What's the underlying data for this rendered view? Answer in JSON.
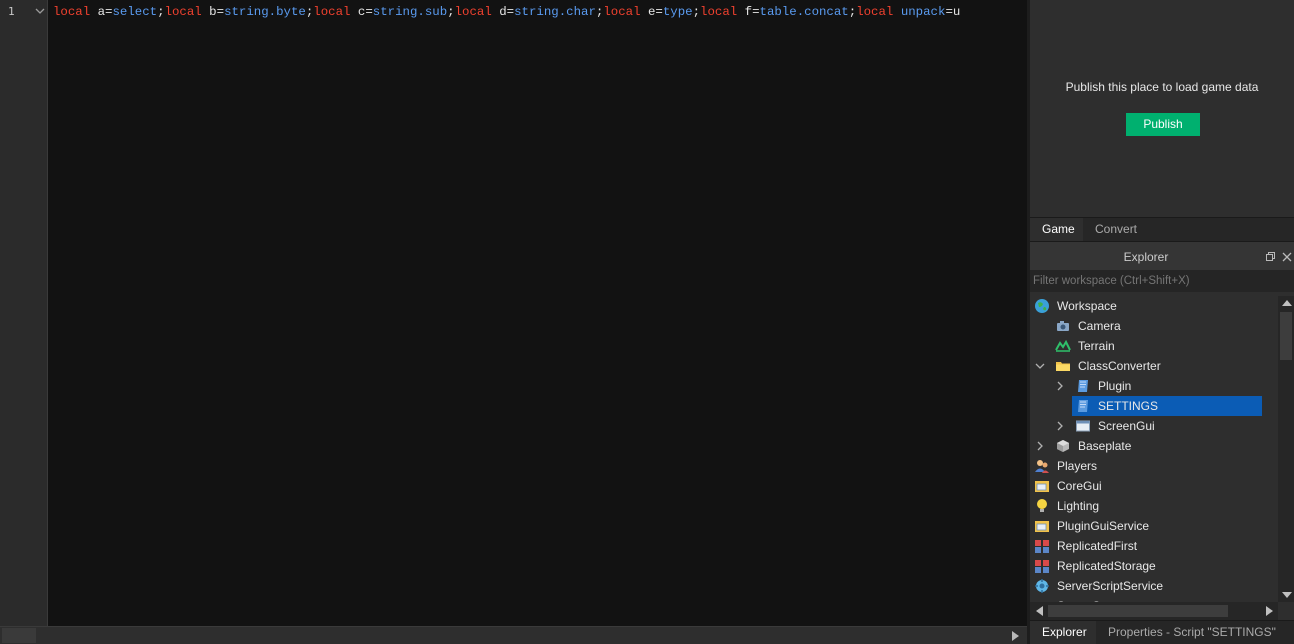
{
  "editor": {
    "line_number": "1",
    "code_tokens": [
      {
        "t": "kw",
        "v": "local"
      },
      {
        "t": "op",
        "v": " a="
      },
      {
        "t": "bi",
        "v": "select"
      },
      {
        "t": "op",
        "v": ";"
      },
      {
        "t": "kw",
        "v": "local"
      },
      {
        "t": "op",
        "v": " b="
      },
      {
        "t": "bi",
        "v": "string.byte"
      },
      {
        "t": "op",
        "v": ";"
      },
      {
        "t": "kw",
        "v": "local"
      },
      {
        "t": "op",
        "v": " c="
      },
      {
        "t": "bi",
        "v": "string.sub"
      },
      {
        "t": "op",
        "v": ";"
      },
      {
        "t": "kw",
        "v": "local"
      },
      {
        "t": "op",
        "v": " d="
      },
      {
        "t": "bi",
        "v": "string.char"
      },
      {
        "t": "op",
        "v": ";"
      },
      {
        "t": "kw",
        "v": "local"
      },
      {
        "t": "op",
        "v": " e="
      },
      {
        "t": "bi",
        "v": "type"
      },
      {
        "t": "op",
        "v": ";"
      },
      {
        "t": "kw",
        "v": "local"
      },
      {
        "t": "op",
        "v": " f="
      },
      {
        "t": "bi",
        "v": "table.concat"
      },
      {
        "t": "op",
        "v": ";"
      },
      {
        "t": "kw",
        "v": "local"
      },
      {
        "t": "op",
        "v": " "
      },
      {
        "t": "bi",
        "v": "unpack"
      },
      {
        "t": "op",
        "v": "=u"
      }
    ]
  },
  "game_panel": {
    "message": "Publish this place to load game data",
    "publish_label": "Publish"
  },
  "top_tabs": [
    {
      "label": "Game",
      "active": true
    },
    {
      "label": "Convert",
      "active": false
    }
  ],
  "explorer": {
    "title": "Explorer",
    "filter_placeholder": "Filter workspace (Ctrl+Shift+X)",
    "items": [
      {
        "label": "Workspace",
        "icon": "globe-icon",
        "indent": 0,
        "chevron": "none",
        "selected": false
      },
      {
        "label": "Camera",
        "icon": "camera-icon",
        "indent": 1,
        "chevron": "none",
        "selected": false
      },
      {
        "label": "Terrain",
        "icon": "terrain-icon",
        "indent": 1,
        "chevron": "none",
        "selected": false
      },
      {
        "label": "ClassConverter",
        "icon": "folder-icon",
        "indent": 1,
        "chevron": "down",
        "selected": false
      },
      {
        "label": "Plugin",
        "icon": "script-icon",
        "indent": 2,
        "chevron": "right",
        "selected": false
      },
      {
        "label": "SETTINGS",
        "icon": "script-icon",
        "indent": 2,
        "chevron": "none",
        "selected": true
      },
      {
        "label": "ScreenGui",
        "icon": "screen-gui-icon",
        "indent": 2,
        "chevron": "right",
        "selected": false
      },
      {
        "label": "Baseplate",
        "icon": "part-icon",
        "indent": 1,
        "chevron": "right",
        "selected": false
      },
      {
        "label": "Players",
        "icon": "players-icon",
        "indent": 0,
        "chevron": "none",
        "selected": false
      },
      {
        "label": "CoreGui",
        "icon": "core-gui-icon",
        "indent": 0,
        "chevron": "none",
        "selected": false
      },
      {
        "label": "Lighting",
        "icon": "lightbulb-icon",
        "indent": 0,
        "chevron": "none",
        "selected": false
      },
      {
        "label": "PluginGuiService",
        "icon": "core-gui-icon",
        "indent": 0,
        "chevron": "none",
        "selected": false
      },
      {
        "label": "ReplicatedFirst",
        "icon": "replicated-icon",
        "indent": 0,
        "chevron": "none",
        "selected": false
      },
      {
        "label": "ReplicatedStorage",
        "icon": "replicated-icon",
        "indent": 0,
        "chevron": "none",
        "selected": false
      },
      {
        "label": "ServerScriptService",
        "icon": "server-script-icon",
        "indent": 0,
        "chevron": "none",
        "selected": false
      },
      {
        "label": "ServerStorage",
        "icon": "server-storage-icon",
        "indent": 0,
        "chevron": "none",
        "selected": false
      }
    ]
  },
  "bottom_tabs": [
    {
      "label": "Explorer",
      "active": true
    },
    {
      "label": "Properties - Script \"SETTINGS\"",
      "active": false
    }
  ],
  "colors": {
    "keyword": "#f0412f",
    "builtin": "#5a9bf0",
    "publish_green": "#00b06f",
    "selection_blue": "#0b5cb5"
  }
}
